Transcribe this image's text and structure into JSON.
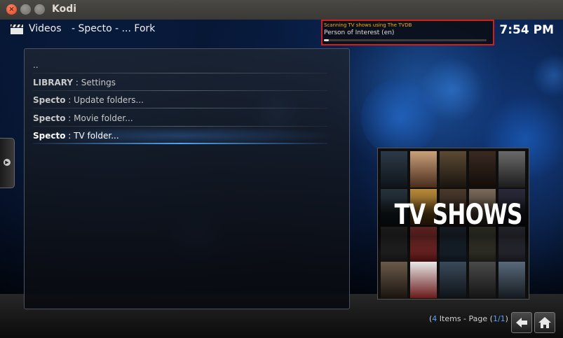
{
  "window": {
    "title": "Kodi",
    "close_glyph": "×"
  },
  "header": {
    "section": "Videos",
    "path": "- Specto - ... Fork",
    "icon": "clapperboard-icon",
    "clock": "7:54 PM"
  },
  "scan_dialog": {
    "title": "Scanning TV shows using The TVDB",
    "item": "Person of Interest (en)",
    "progress": 0.03
  },
  "list": {
    "items": [
      {
        "a": "..",
        "b": ""
      },
      {
        "a": "LIBRARY",
        "b": " : Settings"
      },
      {
        "a": "Specto",
        "b": " : Update folders..."
      },
      {
        "a": "Specto",
        "b": " : Movie folder..."
      },
      {
        "a": "Specto",
        "b": " : TV folder..."
      }
    ],
    "selected_index": 4
  },
  "poster": {
    "text": "TV SHOWS"
  },
  "footer": {
    "count": "4",
    "items_label": " Items - Page (",
    "page": "1/1",
    "close_paren": ")",
    "open_paren": "("
  },
  "colors": {
    "accent": "#5aa0ff",
    "scan_title": "#f3b000",
    "highlight_border": "#d51d1d"
  }
}
